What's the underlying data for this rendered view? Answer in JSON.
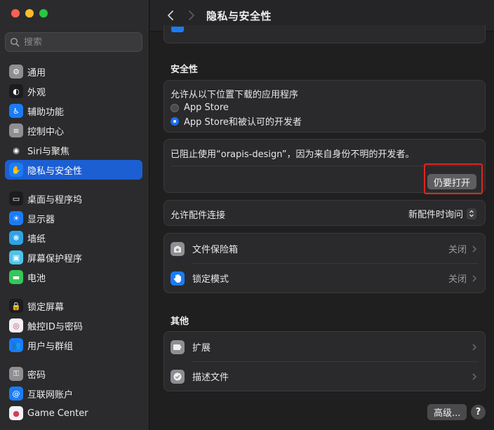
{
  "sidebar": {
    "search_placeholder": "搜索",
    "group1": [
      {
        "label": "通用",
        "icon": "gear-icon",
        "color": "#8e8e93"
      },
      {
        "label": "外观",
        "icon": "appearance-icon",
        "color": "#1c1c1e"
      },
      {
        "label": "辅助功能",
        "icon": "accessibility-icon",
        "color": "#1a7cf5"
      },
      {
        "label": "控制中心",
        "icon": "control-center-icon",
        "color": "#8e8e93"
      },
      {
        "label": "Siri与聚焦",
        "icon": "siri-icon",
        "color": "#2c2c2e"
      },
      {
        "label": "隐私与安全性",
        "icon": "hand-icon",
        "color": "#1a7cf5"
      }
    ],
    "group2": [
      {
        "label": "桌面与程序坞",
        "icon": "dock-icon",
        "color": "#1c1c1e"
      },
      {
        "label": "显示器",
        "icon": "display-icon",
        "color": "#1a7cf5"
      },
      {
        "label": "墙纸",
        "icon": "wallpaper-icon",
        "color": "#2fa3e6"
      },
      {
        "label": "屏幕保护程序",
        "icon": "screensaver-icon",
        "color": "#4fc3e8"
      },
      {
        "label": "电池",
        "icon": "battery-icon",
        "color": "#34c759"
      }
    ],
    "group3": [
      {
        "label": "锁定屏幕",
        "icon": "lock-icon",
        "color": "#1c1c1e"
      },
      {
        "label": "触控ID与密码",
        "icon": "fingerprint-icon",
        "color": "#f2f2f7"
      },
      {
        "label": "用户与群组",
        "icon": "users-icon",
        "color": "#1a7cf5"
      }
    ],
    "group4": [
      {
        "label": "密码",
        "icon": "key-icon",
        "color": "#8e8e93"
      },
      {
        "label": "互联网账户",
        "icon": "at-icon",
        "color": "#1a7cf5"
      },
      {
        "label": "Game Center",
        "icon": "game-center-icon",
        "color": "#f2f2f7"
      }
    ],
    "selected_index": 5
  },
  "toolbar": {
    "title": "隐私与安全性"
  },
  "security": {
    "section_title": "安全性",
    "allow_label": "允许从以下位置下载的应用程序",
    "option_app_store": "App Store",
    "option_app_store_dev": "App Store和被认可的开发者",
    "blocked_message": "已阻止使用“orapis-design”，因为来自身份不明的开发者。",
    "open_anyway": "仍要打开",
    "accessory_label": "允许配件连接",
    "accessory_value": "新配件时询问",
    "filevault_label": "文件保险箱",
    "filevault_value": "关闭",
    "lockdown_label": "锁定模式",
    "lockdown_value": "关闭"
  },
  "other": {
    "section_title": "其他",
    "extensions_label": "扩展",
    "profiles_label": "描述文件"
  },
  "footer": {
    "advanced": "高级...",
    "help": "?"
  },
  "colors": {
    "accent": "#1c5fd3",
    "highlight_box": "#e0251d"
  }
}
